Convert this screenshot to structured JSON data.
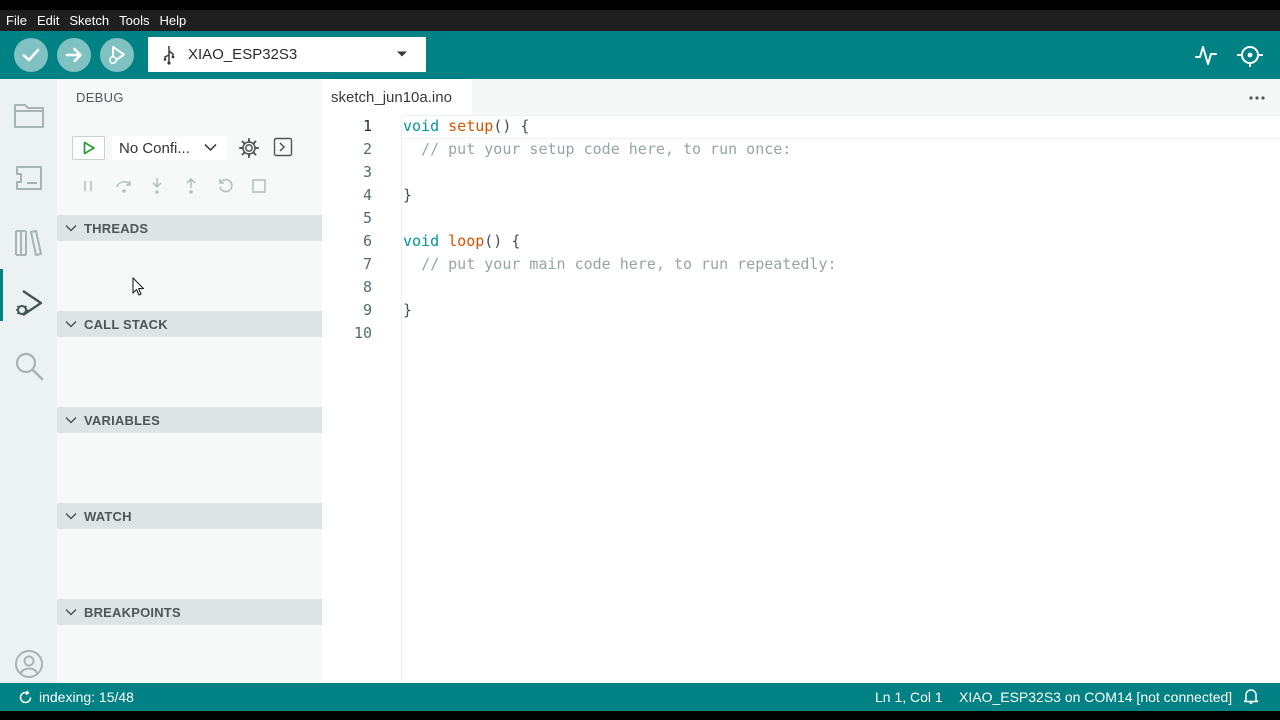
{
  "menu": [
    "File",
    "Edit",
    "Sketch",
    "Tools",
    "Help"
  ],
  "toolbar": {
    "verify_icon": "check-icon",
    "upload_icon": "arrow-right-icon",
    "debug_icon": "debug-icon",
    "board_name": "XIAO_ESP32S3",
    "plotter_icon": "serial-plotter-icon",
    "monitor_icon": "serial-monitor-icon"
  },
  "debug_panel": {
    "title": "DEBUG",
    "config_label": "No Confi...",
    "sections": [
      "THREADS",
      "CALL STACK",
      "VARIABLES",
      "WATCH",
      "BREAKPOINTS"
    ]
  },
  "editor": {
    "tab_label": "sketch_jun10a.ino",
    "lines": [
      {
        "n": "1"
      },
      {
        "n": "2"
      },
      {
        "n": "3"
      },
      {
        "n": "4"
      },
      {
        "n": "5"
      },
      {
        "n": "6"
      },
      {
        "n": "7"
      },
      {
        "n": "8"
      },
      {
        "n": "9"
      },
      {
        "n": "10"
      }
    ],
    "tokens": {
      "void1": "void",
      "setup": "setup",
      "setup_rest": "() {",
      "comment1": "// put your setup code here, to run once:",
      "close1": "}",
      "void2": "void",
      "loop": "loop",
      "loop_rest": "() {",
      "comment2": "// put your main code here, to run repeatedly:",
      "close2": "}"
    }
  },
  "status": {
    "indexing": "indexing: 15/48",
    "position": "Ln 1, Col 1",
    "port": "XIAO_ESP32S3 on COM14 [not connected]"
  },
  "colors": {
    "accent": "#008184",
    "keyword": "#00979c",
    "function": "#d35400",
    "comment": "#95a5a6"
  }
}
